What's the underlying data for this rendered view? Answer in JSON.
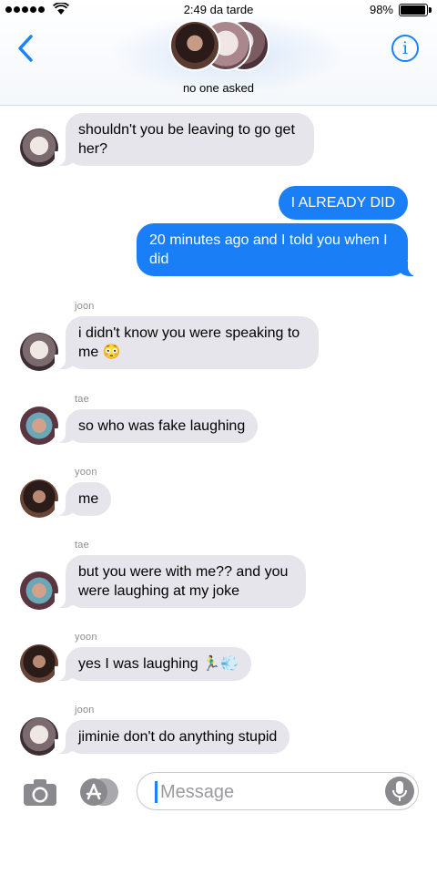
{
  "status_bar": {
    "time": "2:49 da tarde",
    "battery_percent": "98%",
    "battery_level": 0.98,
    "signal_bars": 5
  },
  "header": {
    "group_name": "no one asked",
    "back_icon": "chevron-left-icon",
    "info_icon": "info-icon",
    "info_glyph": "i"
  },
  "messages": [
    {
      "type": "incoming",
      "sender": "",
      "text": "shouldn't you be leaving to go get her?"
    },
    {
      "type": "outgoing",
      "text": "I ALREADY DID"
    },
    {
      "type": "outgoing",
      "text": "20 minutes ago and I told you when I did"
    },
    {
      "type": "incoming",
      "sender": "joon",
      "text": "i didn't know you were speaking to me 😳"
    },
    {
      "type": "incoming",
      "sender": "tae",
      "text": "so who was fake laughing"
    },
    {
      "type": "incoming",
      "sender": "yoon",
      "text": "me"
    },
    {
      "type": "incoming",
      "sender": "tae",
      "text": "but you were with me?? and you were laughing at my joke"
    },
    {
      "type": "incoming",
      "sender": "yoon",
      "text": "yes I was laughing 🏃‍♂️💨"
    },
    {
      "type": "incoming",
      "sender": "joon",
      "text": "jiminie don't do anything stupid"
    }
  ],
  "input_bar": {
    "placeholder": "Message",
    "camera_icon": "camera-icon",
    "apps_icon": "app-store-icon",
    "mic_icon": "microphone-icon"
  },
  "colors": {
    "accent": "#1a82fb",
    "outgoing_bubble": "#1a7ff6",
    "incoming_bubble": "#e6e5eb"
  }
}
